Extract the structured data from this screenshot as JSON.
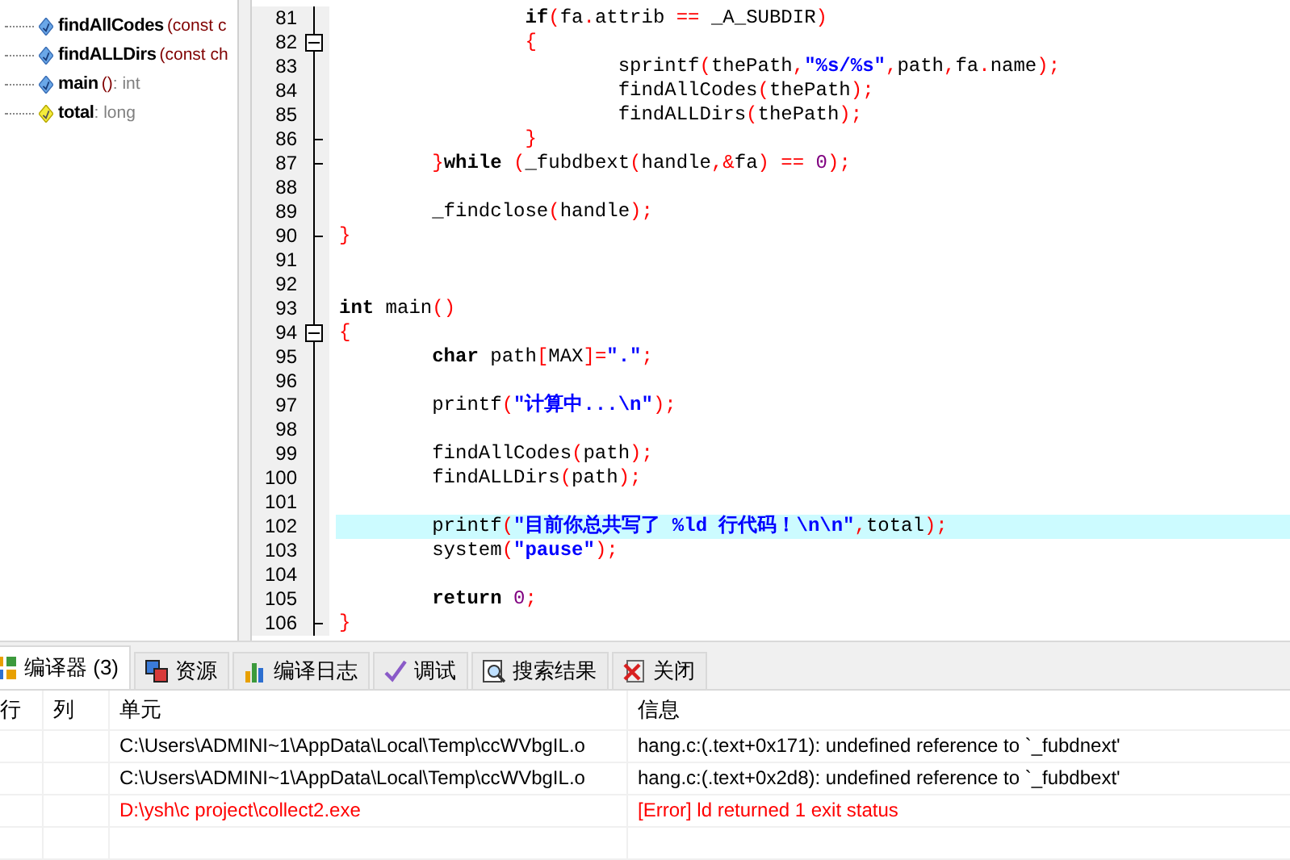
{
  "tree": {
    "items": [
      {
        "kind": "function",
        "name": "findAllCodes",
        "params": "(const c"
      },
      {
        "kind": "function",
        "name": "findALLDirs",
        "params": "(const ch"
      },
      {
        "kind": "function",
        "name": "main",
        "params": "()",
        "type": " : int"
      },
      {
        "kind": "variable",
        "name": "total",
        "type": " : long"
      }
    ]
  },
  "editor": {
    "lines": [
      {
        "number": "81",
        "highlighted": false,
        "tokens": [
          {
            "kind": "kw",
            "text": "\t\tif"
          },
          {
            "kind": "sym",
            "text": "("
          },
          {
            "kind": "id",
            "text": "fa"
          },
          {
            "kind": "sym",
            "text": "."
          },
          {
            "kind": "id",
            "text": "attrib "
          },
          {
            "kind": "sym",
            "text": "=="
          },
          {
            "kind": "id",
            "text": " _A_SUBDIR"
          },
          {
            "kind": "sym",
            "text": ")"
          }
        ]
      },
      {
        "number": "82",
        "kind": "start",
        "highlighted": false,
        "tokens": [
          {
            "kind": "sym",
            "text": "\t\t{"
          }
        ]
      },
      {
        "number": "83",
        "highlighted": false,
        "tokens": [
          {
            "kind": "id",
            "text": "\t\t\tsprintf"
          },
          {
            "kind": "sym",
            "text": "("
          },
          {
            "kind": "id",
            "text": "thePath"
          },
          {
            "kind": "sym",
            "text": ","
          },
          {
            "kind": "str",
            "text": "\"%s/%s\""
          },
          {
            "kind": "sym",
            "text": ","
          },
          {
            "kind": "id",
            "text": "path"
          },
          {
            "kind": "sym",
            "text": ","
          },
          {
            "kind": "id",
            "text": "fa"
          },
          {
            "kind": "sym",
            "text": "."
          },
          {
            "kind": "id",
            "text": "name"
          },
          {
            "kind": "sym",
            "text": ");"
          }
        ]
      },
      {
        "number": "84",
        "highlighted": false,
        "tokens": [
          {
            "kind": "id",
            "text": "\t\t\tfindAllCodes"
          },
          {
            "kind": "sym",
            "text": "("
          },
          {
            "kind": "id",
            "text": "thePath"
          },
          {
            "kind": "sym",
            "text": ");"
          }
        ]
      },
      {
        "number": "85",
        "highlighted": false,
        "tokens": [
          {
            "kind": "id",
            "text": "\t\t\tfindALLDirs"
          },
          {
            "kind": "sym",
            "text": "("
          },
          {
            "kind": "id",
            "text": "thePath"
          },
          {
            "kind": "sym",
            "text": ");"
          }
        ]
      },
      {
        "number": "86",
        "kind": "end",
        "highlighted": false,
        "tokens": [
          {
            "kind": "sym",
            "text": "\t\t}"
          }
        ]
      },
      {
        "number": "87",
        "kind": "end",
        "highlighted": false,
        "tokens": [
          {
            "kind": "sym",
            "text": "\t}"
          },
          {
            "kind": "kw",
            "text": "while "
          },
          {
            "kind": "sym",
            "text": "("
          },
          {
            "kind": "id",
            "text": "_fubdbext"
          },
          {
            "kind": "sym",
            "text": "("
          },
          {
            "kind": "id",
            "text": "handle"
          },
          {
            "kind": "sym",
            "text": ",&"
          },
          {
            "kind": "id",
            "text": "fa"
          },
          {
            "kind": "sym",
            "text": ") == "
          },
          {
            "kind": "num",
            "text": "0"
          },
          {
            "kind": "sym",
            "text": ");"
          }
        ]
      },
      {
        "number": "88",
        "highlighted": false
      },
      {
        "number": "89",
        "highlighted": false,
        "tokens": [
          {
            "kind": "id",
            "text": "\t_findclose"
          },
          {
            "kind": "sym",
            "text": "("
          },
          {
            "kind": "id",
            "text": "handle"
          },
          {
            "kind": "sym",
            "text": ");"
          }
        ]
      },
      {
        "number": "90",
        "kind": "end",
        "highlighted": false,
        "tokens": [
          {
            "kind": "sym",
            "text": "}"
          }
        ]
      },
      {
        "number": "91",
        "highlighted": false
      },
      {
        "number": "92",
        "highlighted": false
      },
      {
        "number": "93",
        "highlighted": false,
        "tokens": [
          {
            "kind": "kw",
            "text": "int"
          },
          {
            "kind": "id",
            "text": " main"
          },
          {
            "kind": "sym",
            "text": "()"
          }
        ]
      },
      {
        "number": "94",
        "kind": "start",
        "highlighted": false,
        "tokens": [
          {
            "kind": "sym",
            "text": "{"
          }
        ]
      },
      {
        "number": "95",
        "highlighted": false,
        "tokens": [
          {
            "kind": "kw",
            "text": "\tchar"
          },
          {
            "kind": "id",
            "text": " path"
          },
          {
            "kind": "sym",
            "text": "["
          },
          {
            "kind": "id",
            "text": "MAX"
          },
          {
            "kind": "sym",
            "text": "]="
          },
          {
            "kind": "str",
            "text": "\".\""
          },
          {
            "kind": "sym",
            "text": ";"
          }
        ]
      },
      {
        "number": "96",
        "highlighted": false
      },
      {
        "number": "97",
        "highlighted": false,
        "tokens": [
          {
            "kind": "id",
            "text": "\tprintf"
          },
          {
            "kind": "sym",
            "text": "("
          },
          {
            "kind": "str",
            "text": "\"计算中...\\n\""
          },
          {
            "kind": "sym",
            "text": ");"
          }
        ]
      },
      {
        "number": "98",
        "highlighted": false
      },
      {
        "number": "99",
        "highlighted": false,
        "tokens": [
          {
            "kind": "id",
            "text": "\tfindAllCodes"
          },
          {
            "kind": "sym",
            "text": "("
          },
          {
            "kind": "id",
            "text": "path"
          },
          {
            "kind": "sym",
            "text": ");"
          }
        ]
      },
      {
        "number": "100",
        "highlighted": false,
        "tokens": [
          {
            "kind": "id",
            "text": "\tfindALLDirs"
          },
          {
            "kind": "sym",
            "text": "("
          },
          {
            "kind": "id",
            "text": "path"
          },
          {
            "kind": "sym",
            "text": ");"
          }
        ]
      },
      {
        "number": "101",
        "highlighted": false
      },
      {
        "number": "102",
        "highlighted": true,
        "tokens": [
          {
            "kind": "id",
            "text": "\tprintf"
          },
          {
            "kind": "sym",
            "text": "("
          },
          {
            "kind": "str",
            "text": "\"目前你总共写了 %ld 行代码！\\n\\n\""
          },
          {
            "kind": "sym",
            "text": ","
          },
          {
            "kind": "id",
            "text": "total"
          },
          {
            "kind": "sym",
            "text": ");"
          }
        ]
      },
      {
        "number": "103",
        "highlighted": false,
        "tokens": [
          {
            "kind": "id",
            "text": "\tsystem"
          },
          {
            "kind": "sym",
            "text": "("
          },
          {
            "kind": "str",
            "text": "\"pause\""
          },
          {
            "kind": "sym",
            "text": ");"
          }
        ]
      },
      {
        "number": "104",
        "highlighted": false
      },
      {
        "number": "105",
        "highlighted": false,
        "tokens": [
          {
            "kind": "kw",
            "text": "\treturn "
          },
          {
            "kind": "num",
            "text": "0"
          },
          {
            "kind": "sym",
            "text": ";"
          }
        ]
      },
      {
        "number": "106",
        "kind": "end",
        "highlighted": false,
        "tokens": [
          {
            "kind": "sym",
            "text": "}"
          }
        ]
      }
    ]
  },
  "bottom_panel": {
    "tabs": [
      {
        "label": "编译器 (3)",
        "selected": true
      },
      {
        "label": "资源",
        "selected": false
      },
      {
        "label": "编译日志",
        "selected": false
      },
      {
        "label": "调试",
        "selected": false
      },
      {
        "label": "搜索结果",
        "selected": false
      },
      {
        "label": "关闭",
        "selected": false
      }
    ],
    "table": {
      "columns": [
        "行",
        "列",
        "单元",
        "信息"
      ],
      "rows": [
        {
          "error": false,
          "unit": "C:\\Users\\ADMINI~1\\AppData\\Local\\Temp\\ccWVbgIL.o",
          "message": "hang.c:(.text+0x171): undefined reference to `_fubdnext'"
        },
        {
          "error": false,
          "unit": "C:\\Users\\ADMINI~1\\AppData\\Local\\Temp\\ccWVbgIL.o",
          "message": "hang.c:(.text+0x2d8): undefined reference to `_fubdbext'"
        },
        {
          "error": true,
          "unit": "D:\\ysh\\c project\\collect2.exe",
          "message": "[Error] ld returned 1 exit status"
        }
      ]
    }
  }
}
